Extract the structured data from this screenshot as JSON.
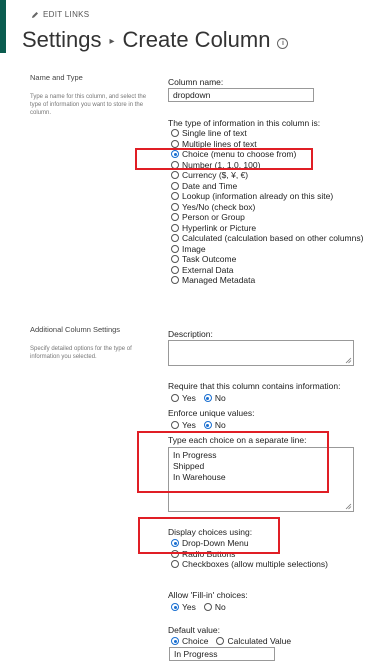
{
  "header": {
    "edit_links": "EDIT LINKS",
    "breadcrumb_root": "Settings",
    "separator": "▸",
    "page_title": "Create Column"
  },
  "name_type_section": {
    "title": "Name and Type",
    "description": "Type a name for this column, and select the type of information you want to store in the column.",
    "column_name_label": "Column name:",
    "column_name_value": "dropdown",
    "type_label": "The type of information in this column is:",
    "types": [
      {
        "label": "Single line of text",
        "selected": false
      },
      {
        "label": "Multiple lines of text",
        "selected": false
      },
      {
        "label": "Choice (menu to choose from)",
        "selected": true
      },
      {
        "label": "Number (1, 1.0, 100)",
        "selected": false
      },
      {
        "label": "Currency ($, ¥, €)",
        "selected": false
      },
      {
        "label": "Date and Time",
        "selected": false
      },
      {
        "label": "Lookup (information already on this site)",
        "selected": false
      },
      {
        "label": "Yes/No (check box)",
        "selected": false
      },
      {
        "label": "Person or Group",
        "selected": false
      },
      {
        "label": "Hyperlink or Picture",
        "selected": false
      },
      {
        "label": "Calculated (calculation based on other columns)",
        "selected": false
      },
      {
        "label": "Image",
        "selected": false
      },
      {
        "label": "Task Outcome",
        "selected": false
      },
      {
        "label": "External Data",
        "selected": false
      },
      {
        "label": "Managed Metadata",
        "selected": false
      }
    ]
  },
  "additional_section": {
    "title": "Additional Column Settings",
    "description": "Specify detailed options for the type of information you selected.",
    "description_label": "Description:",
    "require_label": "Require that this column contains information:",
    "require_yes": "Yes",
    "require_no": "No",
    "unique_label": "Enforce unique values:",
    "unique_yes": "Yes",
    "unique_no": "No",
    "choices_label": "Type each choice on a separate line:",
    "choices": [
      "In Progress",
      "Shipped",
      "In Warehouse"
    ],
    "display_label": "Display choices using:",
    "display_options": [
      {
        "label": "Drop-Down Menu",
        "selected": true
      },
      {
        "label": "Radio Buttons",
        "selected": false
      },
      {
        "label": "Checkboxes (allow multiple selections)",
        "selected": false
      }
    ],
    "fillin_label": "Allow 'Fill-in' choices:",
    "fillin_yes": "Yes",
    "fillin_no": "No",
    "default_label": "Default value:",
    "default_choice": "Choice",
    "default_calculated": "Calculated Value",
    "default_value": "In Progress"
  },
  "colors": {
    "accent_bar": "#0b5c4f",
    "highlight_box": "#e01e25",
    "radio_selected": "#1a6fd1"
  }
}
